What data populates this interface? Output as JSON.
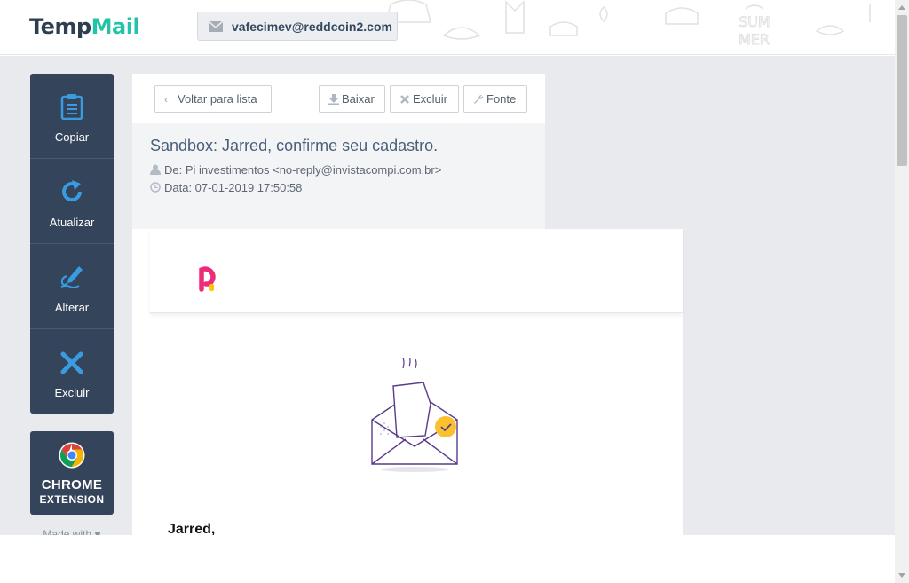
{
  "header": {
    "logo_part1": "Temp",
    "logo_part2": "Mail",
    "email_address": "vafecimev@reddcoin2.com"
  },
  "sidebar": {
    "items": [
      {
        "label": "Copiar",
        "icon": "clipboard-icon"
      },
      {
        "label": "Atualizar",
        "icon": "refresh-icon"
      },
      {
        "label": "Alterar",
        "icon": "edit-pen-icon"
      },
      {
        "label": "Excluir",
        "icon": "close-icon"
      }
    ],
    "chrome": {
      "line1": "CHROME",
      "line2": "EXTENSION"
    },
    "footer": "Made with ♥"
  },
  "toolbar": {
    "back_label": "Voltar para lista",
    "download_label": "Baixar",
    "delete_label": "Excluir",
    "source_label": "Fonte"
  },
  "message": {
    "subject": "Sandbox: Jarred, confirme seu cadastro.",
    "from": "De: Pi investimentos <no-reply@invistacompi.com.br>",
    "date": "Data: 07-01-2019 17:50:58",
    "greeting": "Jarred,"
  },
  "colors": {
    "sidebar": "#34455b",
    "accent": "#21c4a6",
    "icon_blue": "#3a9be0",
    "subject": "#4a5e7a"
  }
}
